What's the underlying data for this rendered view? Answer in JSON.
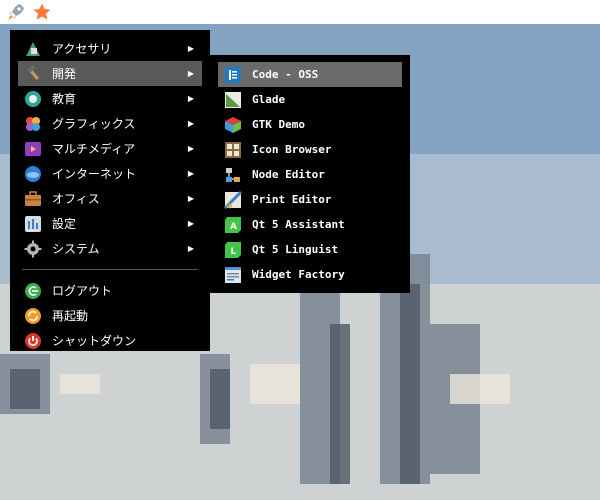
{
  "main_menu": {
    "items": [
      {
        "label": "アクセサリ",
        "icon": "accessories-icon"
      },
      {
        "label": "開発",
        "icon": "development-icon"
      },
      {
        "label": "教育",
        "icon": "education-icon"
      },
      {
        "label": "グラフィックス",
        "icon": "graphics-icon"
      },
      {
        "label": "マルチメディア",
        "icon": "multimedia-icon"
      },
      {
        "label": "インターネット",
        "icon": "internet-icon"
      },
      {
        "label": "オフィス",
        "icon": "office-icon"
      },
      {
        "label": "設定",
        "icon": "settings-icon"
      },
      {
        "label": "システム",
        "icon": "system-icon"
      }
    ],
    "actions": [
      {
        "label": "ログアウト",
        "icon": "logout-icon"
      },
      {
        "label": "再起動",
        "icon": "reboot-icon"
      },
      {
        "label": "シャットダウン",
        "icon": "shutdown-icon"
      }
    ]
  },
  "sub_menu": {
    "items": [
      {
        "label": "Code - OSS",
        "icon": "vscode-icon"
      },
      {
        "label": "Glade",
        "icon": "glade-icon"
      },
      {
        "label": "GTK Demo",
        "icon": "gtk-icon"
      },
      {
        "label": "Icon Browser",
        "icon": "icon-browser-icon"
      },
      {
        "label": "Node Editor",
        "icon": "node-editor-icon"
      },
      {
        "label": "Print Editor",
        "icon": "print-editor-icon"
      },
      {
        "label": "Qt 5 Assistant",
        "icon": "qt-assistant-icon"
      },
      {
        "label": "Qt 5 Linguist",
        "icon": "qt-linguist-icon"
      },
      {
        "label": "Widget Factory",
        "icon": "widget-factory-icon"
      }
    ]
  },
  "colors": {
    "menu_bg": "#000000",
    "highlight": "#5a5a5a",
    "text": "#ffffff"
  }
}
